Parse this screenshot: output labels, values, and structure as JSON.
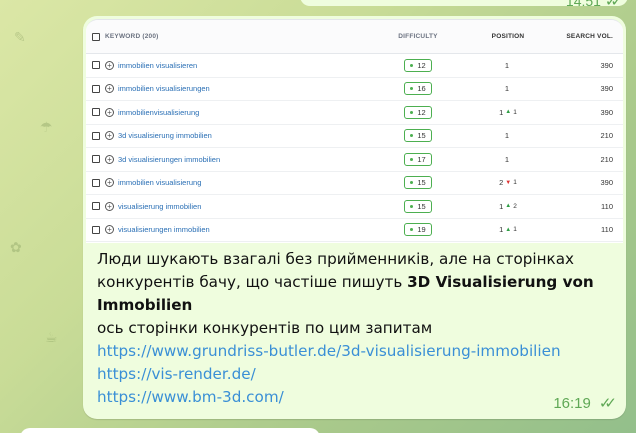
{
  "prev_message": {
    "time": "14:51"
  },
  "table": {
    "headers": {
      "keyword": "KEYWORD (200)",
      "difficulty": "DIFFICULTY",
      "position": "POSITION",
      "volume": "SEARCH VOL."
    },
    "rows": [
      {
        "keyword": "immobilien visualisieren",
        "difficulty": "12",
        "position": "1",
        "change": "",
        "dir": "",
        "volume": "390"
      },
      {
        "keyword": "immobilien visualisierungen",
        "difficulty": "16",
        "position": "1",
        "change": "",
        "dir": "",
        "volume": "390"
      },
      {
        "keyword": "immobilienvisualisierung",
        "difficulty": "12",
        "position": "1",
        "change": "1",
        "dir": "up",
        "volume": "390"
      },
      {
        "keyword": "3d visualisierung immobilien",
        "difficulty": "15",
        "position": "1",
        "change": "",
        "dir": "",
        "volume": "210"
      },
      {
        "keyword": "3d visualisierungen immobilien",
        "difficulty": "17",
        "position": "1",
        "change": "",
        "dir": "",
        "volume": "210"
      },
      {
        "keyword": "immobilien visualisierung",
        "difficulty": "15",
        "position": "2",
        "change": "1",
        "dir": "down",
        "volume": "390"
      },
      {
        "keyword": "visualisierung immobilien",
        "difficulty": "15",
        "position": "1",
        "change": "2",
        "dir": "up",
        "volume": "110"
      },
      {
        "keyword": "visualisierungen immobilien",
        "difficulty": "19",
        "position": "1",
        "change": "1",
        "dir": "up",
        "volume": "110"
      }
    ]
  },
  "message": {
    "text_part1": "Люди шукають взагалі без прийменників, але на сторінках конкурентів бачу, що частіше пишуть ",
    "bold": "3D Visualisierung von Immobilien",
    "text_part2": "ось сторінки конкурентів по цим запитам",
    "links": [
      "https://www.grundriss-butler.de/3d-visualisierung-immobilien",
      "https://vis-render.de/",
      "https://www.bm-3d.com/"
    ],
    "time": "16:19"
  },
  "colors": {
    "bubble": "#effdde",
    "link": "#3a8fd6",
    "meta": "#5fa855",
    "pill_border": "#4caf50"
  }
}
